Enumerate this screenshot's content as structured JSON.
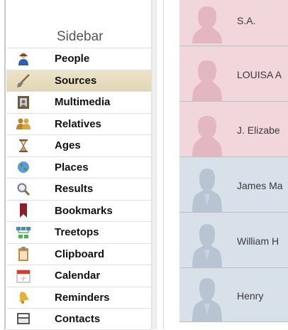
{
  "sidebar": {
    "title": "Sidebar",
    "items": [
      {
        "label": "People",
        "icon": "person-icon",
        "selected": false
      },
      {
        "label": "Sources",
        "icon": "shovel-icon",
        "selected": true
      },
      {
        "label": "Multimedia",
        "icon": "picture-frame-icon",
        "selected": false
      },
      {
        "label": "Relatives",
        "icon": "relatives-icon",
        "selected": false
      },
      {
        "label": "Ages",
        "icon": "hourglass-icon",
        "selected": false
      },
      {
        "label": "Places",
        "icon": "globe-icon",
        "selected": false
      },
      {
        "label": "Results",
        "icon": "magnifier-icon",
        "selected": false
      },
      {
        "label": "Bookmarks",
        "icon": "bookmark-icon",
        "selected": false
      },
      {
        "label": "Treetops",
        "icon": "tree-chart-icon",
        "selected": false
      },
      {
        "label": "Clipboard",
        "icon": "clipboard-icon",
        "selected": false
      },
      {
        "label": "Calendar",
        "icon": "calendar-icon",
        "selected": false
      },
      {
        "label": "Reminders",
        "icon": "bell-icon",
        "selected": false
      },
      {
        "label": "Contacts",
        "icon": "contact-card-icon",
        "selected": false
      }
    ]
  },
  "people": [
    {
      "name": "S.A.",
      "gender": "female"
    },
    {
      "name": "LOUISA A",
      "gender": "female"
    },
    {
      "name": "J. Elizabe",
      "gender": "female"
    },
    {
      "name": "James Ma",
      "gender": "male"
    },
    {
      "name": "William H",
      "gender": "male"
    },
    {
      "name": "Henry",
      "gender": "male"
    }
  ],
  "colors": {
    "female_card": "#f1d7dc",
    "male_card": "#d8e0ea",
    "selected_item": "#e6dcbd"
  }
}
